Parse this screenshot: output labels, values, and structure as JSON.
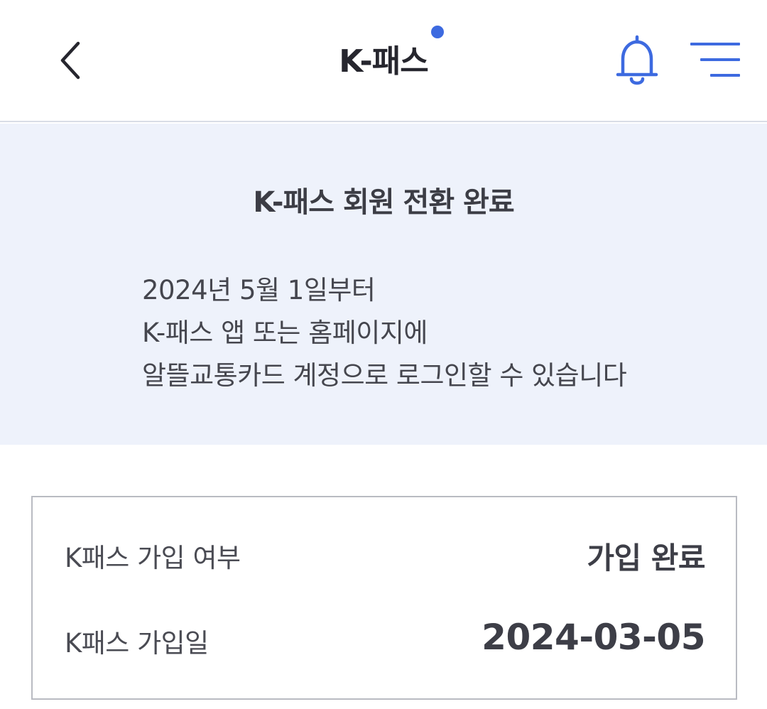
{
  "header": {
    "title": "K-패스",
    "accent_color": "#3d6ae0",
    "back_icon": "chevron-left-icon",
    "bell_icon": "bell-icon",
    "menu_icon": "menu-icon"
  },
  "banner": {
    "title": "K-패스 회원 전환 완료",
    "lines": [
      "2024년 5월 1일부터",
      "K-패스 앱 또는 홈페이지에",
      "알뜰교통카드 계정으로 로그인할 수 있습니다"
    ],
    "background_color": "#eef2fb"
  },
  "info": {
    "rows": [
      {
        "label": "K패스 가입 여부",
        "value": "가입 완료"
      },
      {
        "label": "K패스 가입일",
        "value": "2024-03-05"
      }
    ]
  }
}
